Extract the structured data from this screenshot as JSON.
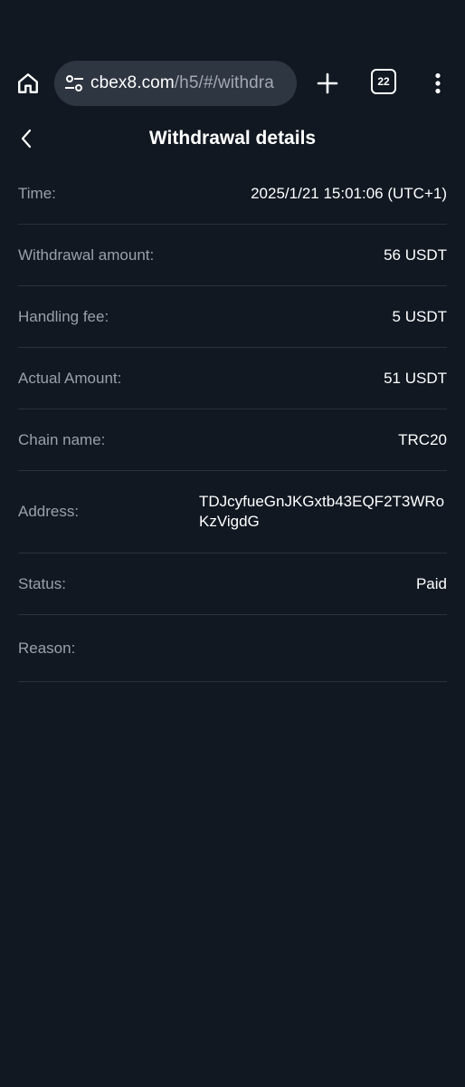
{
  "browser": {
    "url_domain": "cbex8.com",
    "url_path": "/h5/#/withdra",
    "tab_count": "22"
  },
  "header": {
    "title": "Withdrawal details"
  },
  "details": [
    {
      "label": "Time:",
      "value": "2025/1/21 15:01:06 (UTC+1)"
    },
    {
      "label": "Withdrawal amount:",
      "value": "56 USDT"
    },
    {
      "label": "Handling fee:",
      "value": "5 USDT"
    },
    {
      "label": "Actual Amount:",
      "value": "51 USDT"
    },
    {
      "label": "Chain name:",
      "value": "TRC20"
    },
    {
      "label": "Address:",
      "value": "TDJcyfueGnJKGxtb43EQF2T3WRoKzVigdG"
    },
    {
      "label": "Status:",
      "value": "Paid"
    },
    {
      "label": "Reason:",
      "value": ""
    }
  ],
  "colors": {
    "background": "#111822",
    "url_pill": "#2e3642",
    "label": "#9aa0a8",
    "divider": "#2a313b"
  },
  "icons": {
    "home": "home-icon",
    "site_settings": "tune-icon",
    "add_tab": "plus-icon",
    "menu": "more-vert-icon",
    "back": "chevron-left-icon"
  }
}
